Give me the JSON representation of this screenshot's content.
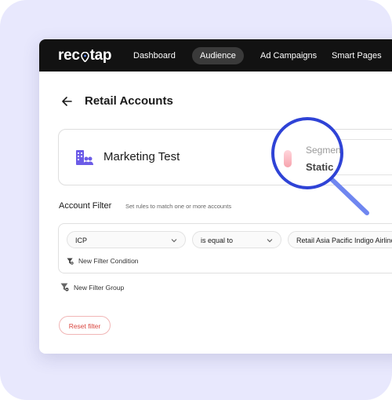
{
  "app": {
    "logo": "recotap"
  },
  "nav": {
    "items": [
      {
        "label": "Dashboard",
        "active": false
      },
      {
        "label": "Audience",
        "active": true
      },
      {
        "label": "Ad Campaigns",
        "active": false
      },
      {
        "label": "Smart Pages",
        "active": false
      }
    ]
  },
  "page": {
    "title": "Retail Accounts"
  },
  "segment": {
    "name": "Marketing Test",
    "type_label": "Segment",
    "type_value": "Static"
  },
  "filter": {
    "label": "Account Filter",
    "hint": "Set rules to match one or more accounts",
    "condition": {
      "field": "ICP",
      "operator": "is equal to",
      "value": "Retail Asia Pacific Indigo Airlines"
    },
    "new_condition_label": "New Filter Condition",
    "new_group_label": "New Filter Group"
  },
  "actions": {
    "reset_label": "Reset filter"
  },
  "colors": {
    "nav_bg": "#121212",
    "accent_blue": "#2f43d6",
    "danger": "#d9463f",
    "icon_purple": "#6c5ce7",
    "background": "#e8e8fd"
  },
  "icons": [
    "back-arrow-icon",
    "building-users-icon",
    "info-icon",
    "chevron-down-icon",
    "filter-add-icon",
    "filter-remove-icon",
    "magnifier-icon"
  ]
}
